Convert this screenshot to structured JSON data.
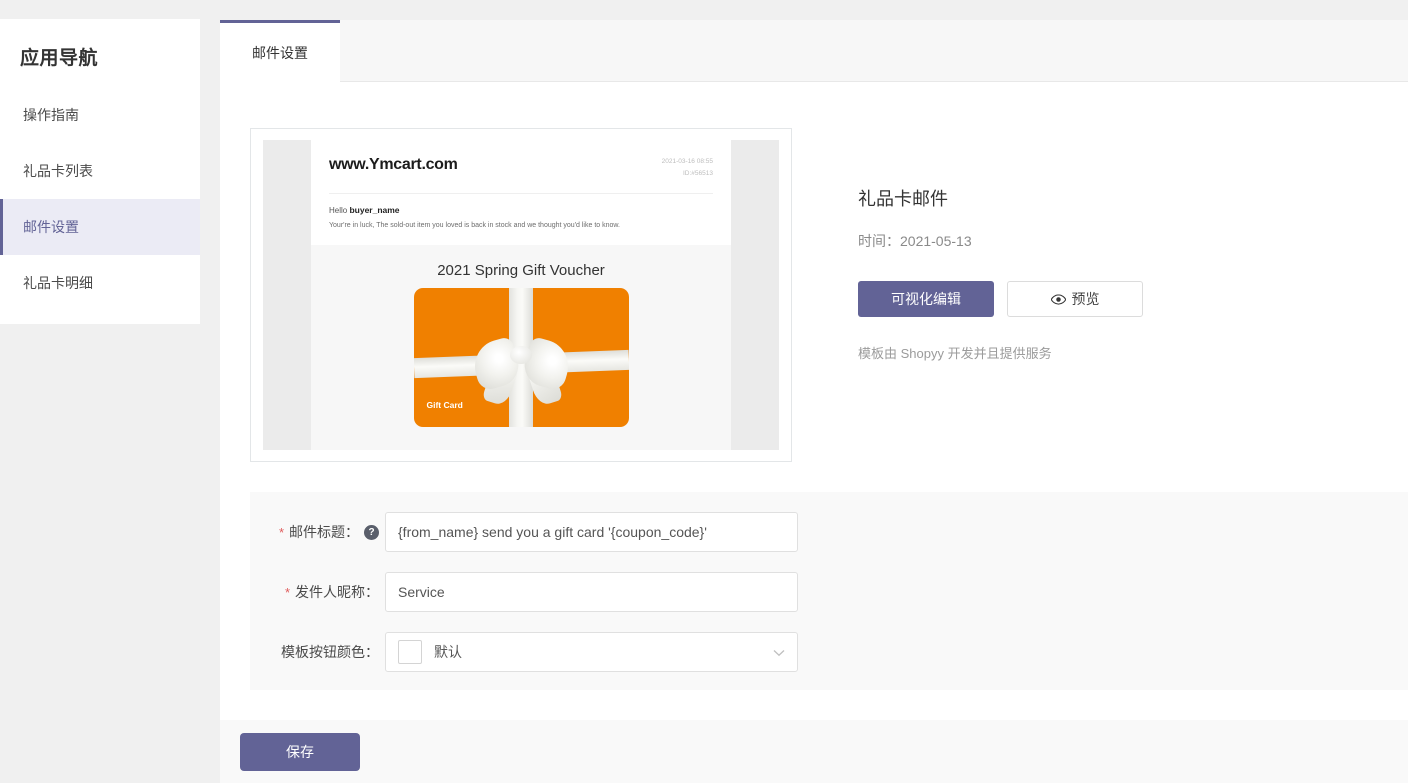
{
  "sidebar": {
    "title": "应用导航",
    "items": [
      {
        "label": "操作指南",
        "active": false
      },
      {
        "label": "礼品卡列表",
        "active": false
      },
      {
        "label": "邮件设置",
        "active": true
      },
      {
        "label": "礼品卡明细",
        "active": false
      }
    ]
  },
  "tabs": [
    {
      "label": "邮件设置",
      "active": true
    }
  ],
  "preview": {
    "mail": {
      "domain": "www.Ymcart.com",
      "date": "2021-03-16 08:55",
      "id": "ID:#56513",
      "greeting_prefix": "Hello ",
      "greeting_name": "buyer_name",
      "body_text": "Your're in luck, The sold-out item you loved is back in stock and we thought you'd like to know.",
      "voucher_title": "2021 Spring Gift Voucher",
      "card_label": "Gift Card"
    }
  },
  "info": {
    "title": "礼品卡邮件",
    "time": "时间：2021-05-13",
    "edit_button": "可视化编辑",
    "preview_button": "预览",
    "preview_icon": "eye-icon",
    "note": "模板由 Shopyy 开发并且提供服务"
  },
  "form": {
    "rows": [
      {
        "label": "邮件标题：",
        "required": true,
        "help": "?",
        "value": "{from_name} send you a gift card '{coupon_code}'",
        "type": "text"
      },
      {
        "label": "发件人昵称：",
        "required": true,
        "value": "Service",
        "type": "text"
      },
      {
        "label": "模板按钮颜色：",
        "required": false,
        "value": "默认",
        "type": "select",
        "swatch": "#ffffff"
      }
    ]
  },
  "footer": {
    "save_label": "保存"
  },
  "colors": {
    "accent": "#626396",
    "accent_bg": "#ebebf5",
    "page_bg": "#f0f0f0",
    "panel_bg": "#f9f9f9",
    "card_orange": "#f08000",
    "required_star": "#e05c5c"
  }
}
